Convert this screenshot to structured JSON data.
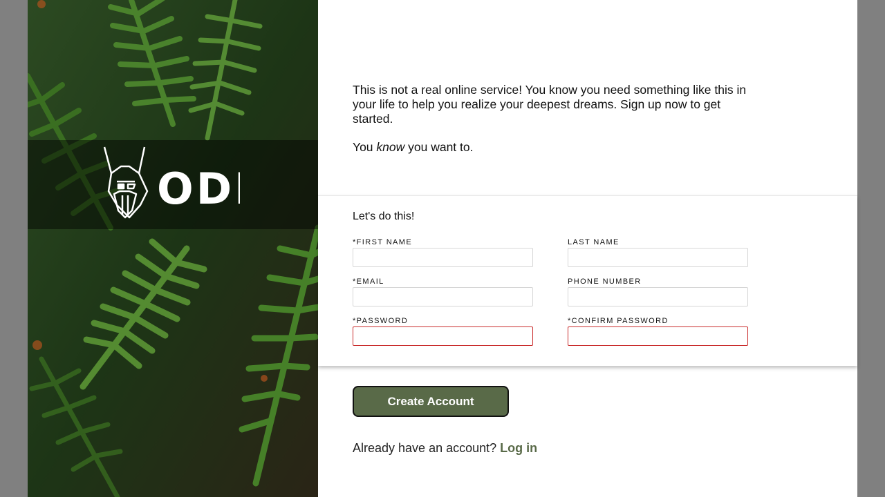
{
  "colors": {
    "accent": "#596a48",
    "error_border": "#c92a2a",
    "frame": "#808080",
    "panel": "#ffffff"
  },
  "sidebar": {
    "logo_text": "ODIN",
    "logo_icon": "viking-helmet-icon",
    "background": "fern-leaves-photo"
  },
  "intro": {
    "paragraph": "This is not a real online service! You know you need something like this in your life to help you realize your deepest dreams. Sign up now to get started.",
    "tagline_before": "You ",
    "tagline_emph": "know",
    "tagline_after": " you want to."
  },
  "form": {
    "heading": "Let's do this!",
    "fields": {
      "first_name": {
        "label": "*FIRST NAME",
        "value": ""
      },
      "last_name": {
        "label": "LAST NAME",
        "value": ""
      },
      "email": {
        "label": "*EMAIL",
        "value": ""
      },
      "phone": {
        "label": "PHONE NUMBER",
        "value": ""
      },
      "password": {
        "label": "*PASSWORD",
        "value": ""
      },
      "confirm_password": {
        "label": "*CONFIRM PASSWORD",
        "value": ""
      }
    }
  },
  "actions": {
    "create_label": "Create Account",
    "login_prompt": "Already have an account? ",
    "login_link": "Log in"
  }
}
